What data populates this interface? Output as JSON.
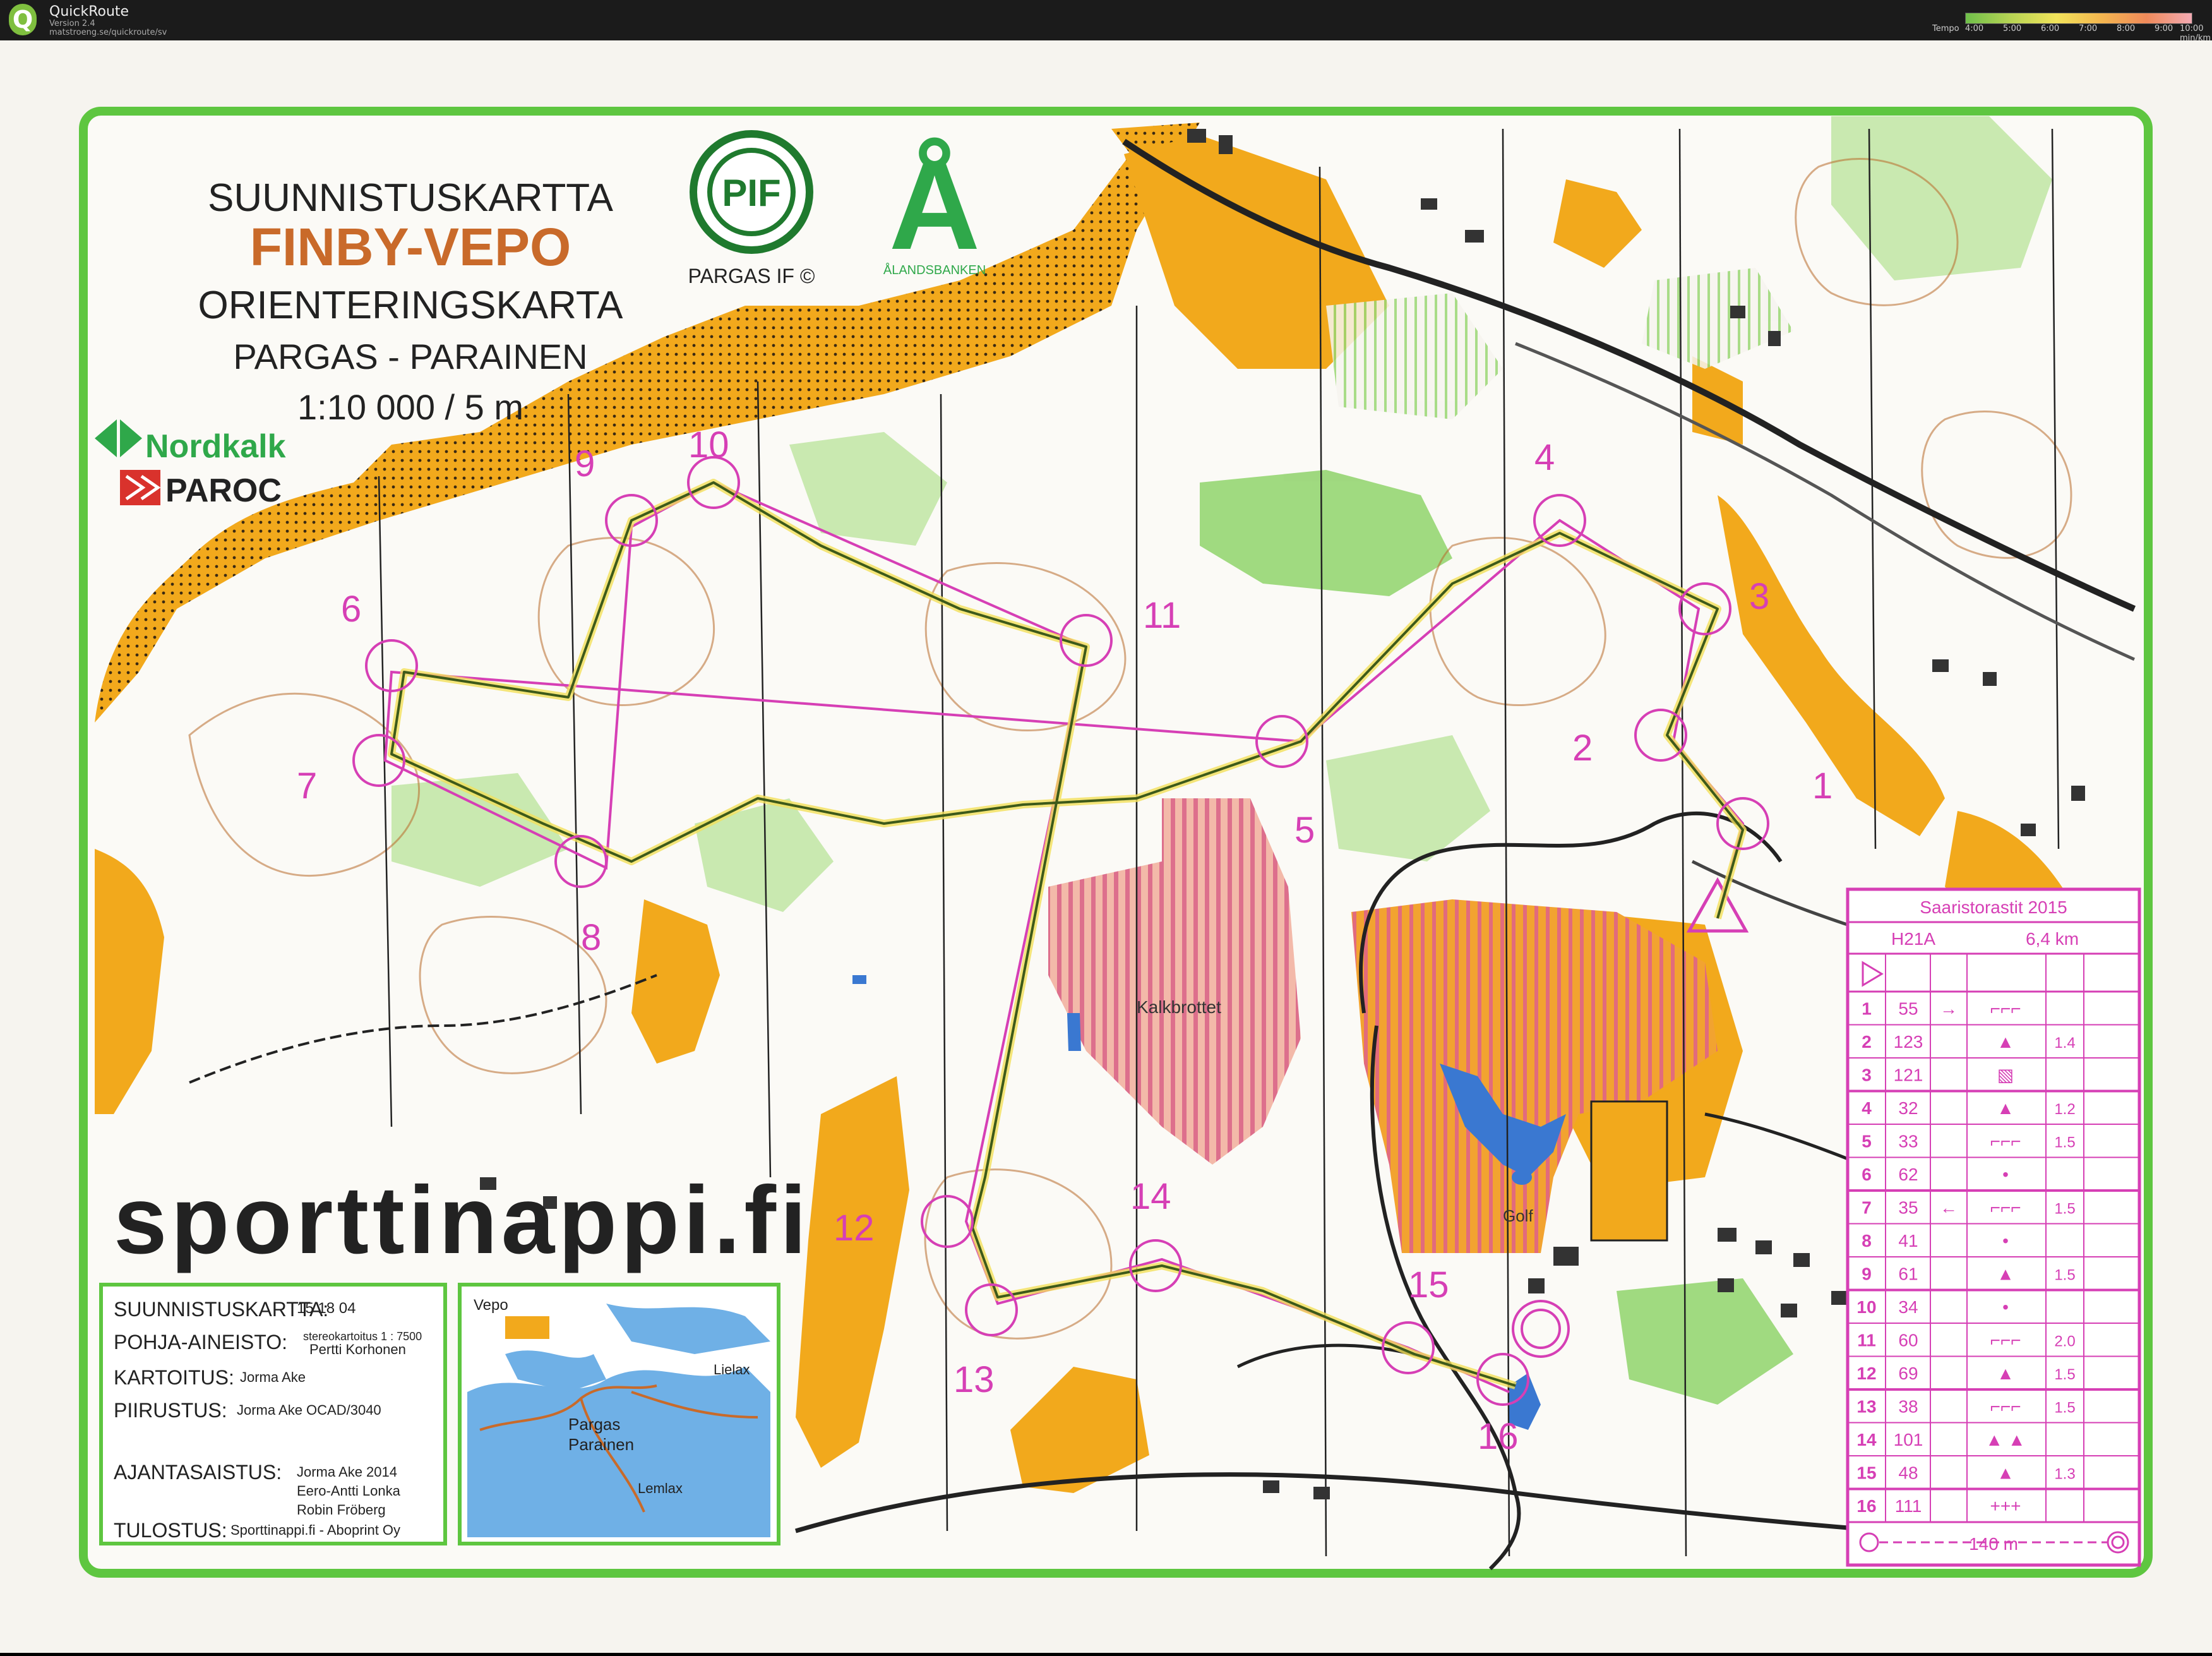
{
  "app": {
    "title": "QuickRoute",
    "version": "Version 2.4",
    "url": "matstroeng.se/quickroute/sv"
  },
  "legend": {
    "label": "Tempo",
    "ticks": [
      "4:00",
      "5:00",
      "6:00",
      "7:00",
      "8:00",
      "9:00",
      "10:00 min/km"
    ]
  },
  "map_header": {
    "line1": "SUUNNISTUSKARTTA",
    "line2": "FINBY-VEPO",
    "line3": "ORIENTERINGSKARTA",
    "line4": "PARGAS - PARAINEN",
    "line5": "1:10 000 / 5 m",
    "club_badge": "PIF",
    "club_name": "PARGAS IF ©",
    "bank_mark": "Å",
    "bank_name": "ÅLANDSBANKEN",
    "sponsor1": "Nordkalk",
    "sponsor2": "PAROC",
    "sponsor3": "sporttinappi.fi"
  },
  "credits": [
    {
      "label": "SUUNNISTUSKARTTA:",
      "value": "15 18 04"
    },
    {
      "label": "POHJA-AINEISTO:",
      "value": "stereokartoitus 1 : 7500",
      "value2": "Pertti Korhonen"
    },
    {
      "label": "KARTOITUS:",
      "value": "Jorma Ake"
    },
    {
      "label": "PIIRUSTUS:",
      "value": "Jorma Ake OCAD/3040"
    },
    {
      "label": "AJANTASAISTUS:",
      "value": "Jorma Ake 2014",
      "value2": "Eero-Antti Lonka",
      "value3": "Robin Fröberg"
    },
    {
      "label": "TULOSTUS:",
      "value": "Sporttinappi.fi - Aboprint Oy"
    }
  ],
  "inset": {
    "label1": "Vepo",
    "label2": "Lielax",
    "label3": "Pargas",
    "label4": "Parainen",
    "label5": "Lemlax"
  },
  "place_names": {
    "kalkbrott": "Kalkbrottet",
    "golf": "Golf"
  },
  "controls": [
    {
      "n": "1"
    },
    {
      "n": "2"
    },
    {
      "n": "3"
    },
    {
      "n": "4"
    },
    {
      "n": "5"
    },
    {
      "n": "6"
    },
    {
      "n": "7"
    },
    {
      "n": "8"
    },
    {
      "n": "9"
    },
    {
      "n": "10"
    },
    {
      "n": "11"
    },
    {
      "n": "12"
    },
    {
      "n": "13"
    },
    {
      "n": "14"
    },
    {
      "n": "15"
    },
    {
      "n": "16"
    }
  ],
  "description_table": {
    "event": "Saaristorastit 2015",
    "class": "H21A",
    "length": "6,4 km",
    "rows": [
      {
        "num": "1",
        "code": "55",
        "dir": "→",
        "feat": "⌐⌐⌐",
        "dist": ""
      },
      {
        "num": "2",
        "code": "123",
        "dir": "",
        "feat": "▲",
        "dist": "1.4"
      },
      {
        "num": "3",
        "code": "121",
        "dir": "",
        "feat": "▧",
        "dist": ""
      },
      {
        "num": "4",
        "code": "32",
        "dir": "",
        "feat": "▲",
        "dist": "1.2"
      },
      {
        "num": "5",
        "code": "33",
        "dir": "",
        "feat": "⌐⌐⌐",
        "dist": "1.5"
      },
      {
        "num": "6",
        "code": "62",
        "dir": "",
        "feat": "•",
        "dist": ""
      },
      {
        "num": "7",
        "code": "35",
        "dir": "←",
        "feat": "⌐⌐⌐",
        "dist": "1.5"
      },
      {
        "num": "8",
        "code": "41",
        "dir": "",
        "feat": "•",
        "dist": ""
      },
      {
        "num": "9",
        "code": "61",
        "dir": "",
        "feat": "▲",
        "dist": "1.5"
      },
      {
        "num": "10",
        "code": "34",
        "dir": "",
        "feat": "•",
        "dist": ""
      },
      {
        "num": "11",
        "code": "60",
        "dir": "",
        "feat": "⌐⌐⌐",
        "dist": "2.0"
      },
      {
        "num": "12",
        "code": "69",
        "dir": "",
        "feat": "▲",
        "dist": "1.5"
      },
      {
        "num": "13",
        "code": "38",
        "dir": "",
        "feat": "⌐⌐⌐",
        "dist": "1.5"
      },
      {
        "num": "14",
        "code": "101",
        "dir": "",
        "feat": "▲ ▲",
        "dist": ""
      },
      {
        "num": "15",
        "code": "48",
        "dir": "",
        "feat": "▲",
        "dist": "1.3"
      },
      {
        "num": "16",
        "code": "111",
        "dir": "",
        "feat": "+++",
        "dist": ""
      }
    ],
    "finish": "140 m"
  },
  "colors": {
    "open_land": "#f2a91c",
    "vegetation": "#8fd36b",
    "border": "#5ec640",
    "course": "#d63fb5",
    "route": "#3d5a1a",
    "road": "#222222",
    "water": "#3a78d1",
    "out_of_bounds": "#e7948e"
  }
}
